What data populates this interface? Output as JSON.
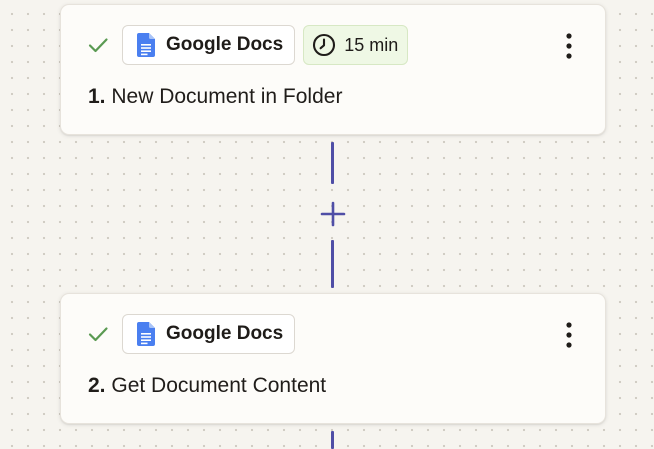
{
  "steps": [
    {
      "number": "1.",
      "title": "New Document in Folder",
      "app_name": "Google Docs",
      "app_icon": "google-docs-icon",
      "status_icon": "check-icon",
      "poll_interval": "15 min",
      "poll_icon": "clock-icon",
      "menu_icon": "more-vertical-icon"
    },
    {
      "number": "2.",
      "title": "Get Document Content",
      "app_name": "Google Docs",
      "app_icon": "google-docs-icon",
      "status_icon": "check-icon",
      "menu_icon": "more-vertical-icon"
    }
  ],
  "connector": {
    "add_icon": "plus-icon"
  },
  "colors": {
    "canvas_background": "#f6f4ef",
    "card_background": "#fdfcf9",
    "check_green": "#5a9a52",
    "connector_purple": "#4f4ea6",
    "google_docs_blue": "#4a7ff0",
    "poll_badge_background": "#eff8e5"
  }
}
